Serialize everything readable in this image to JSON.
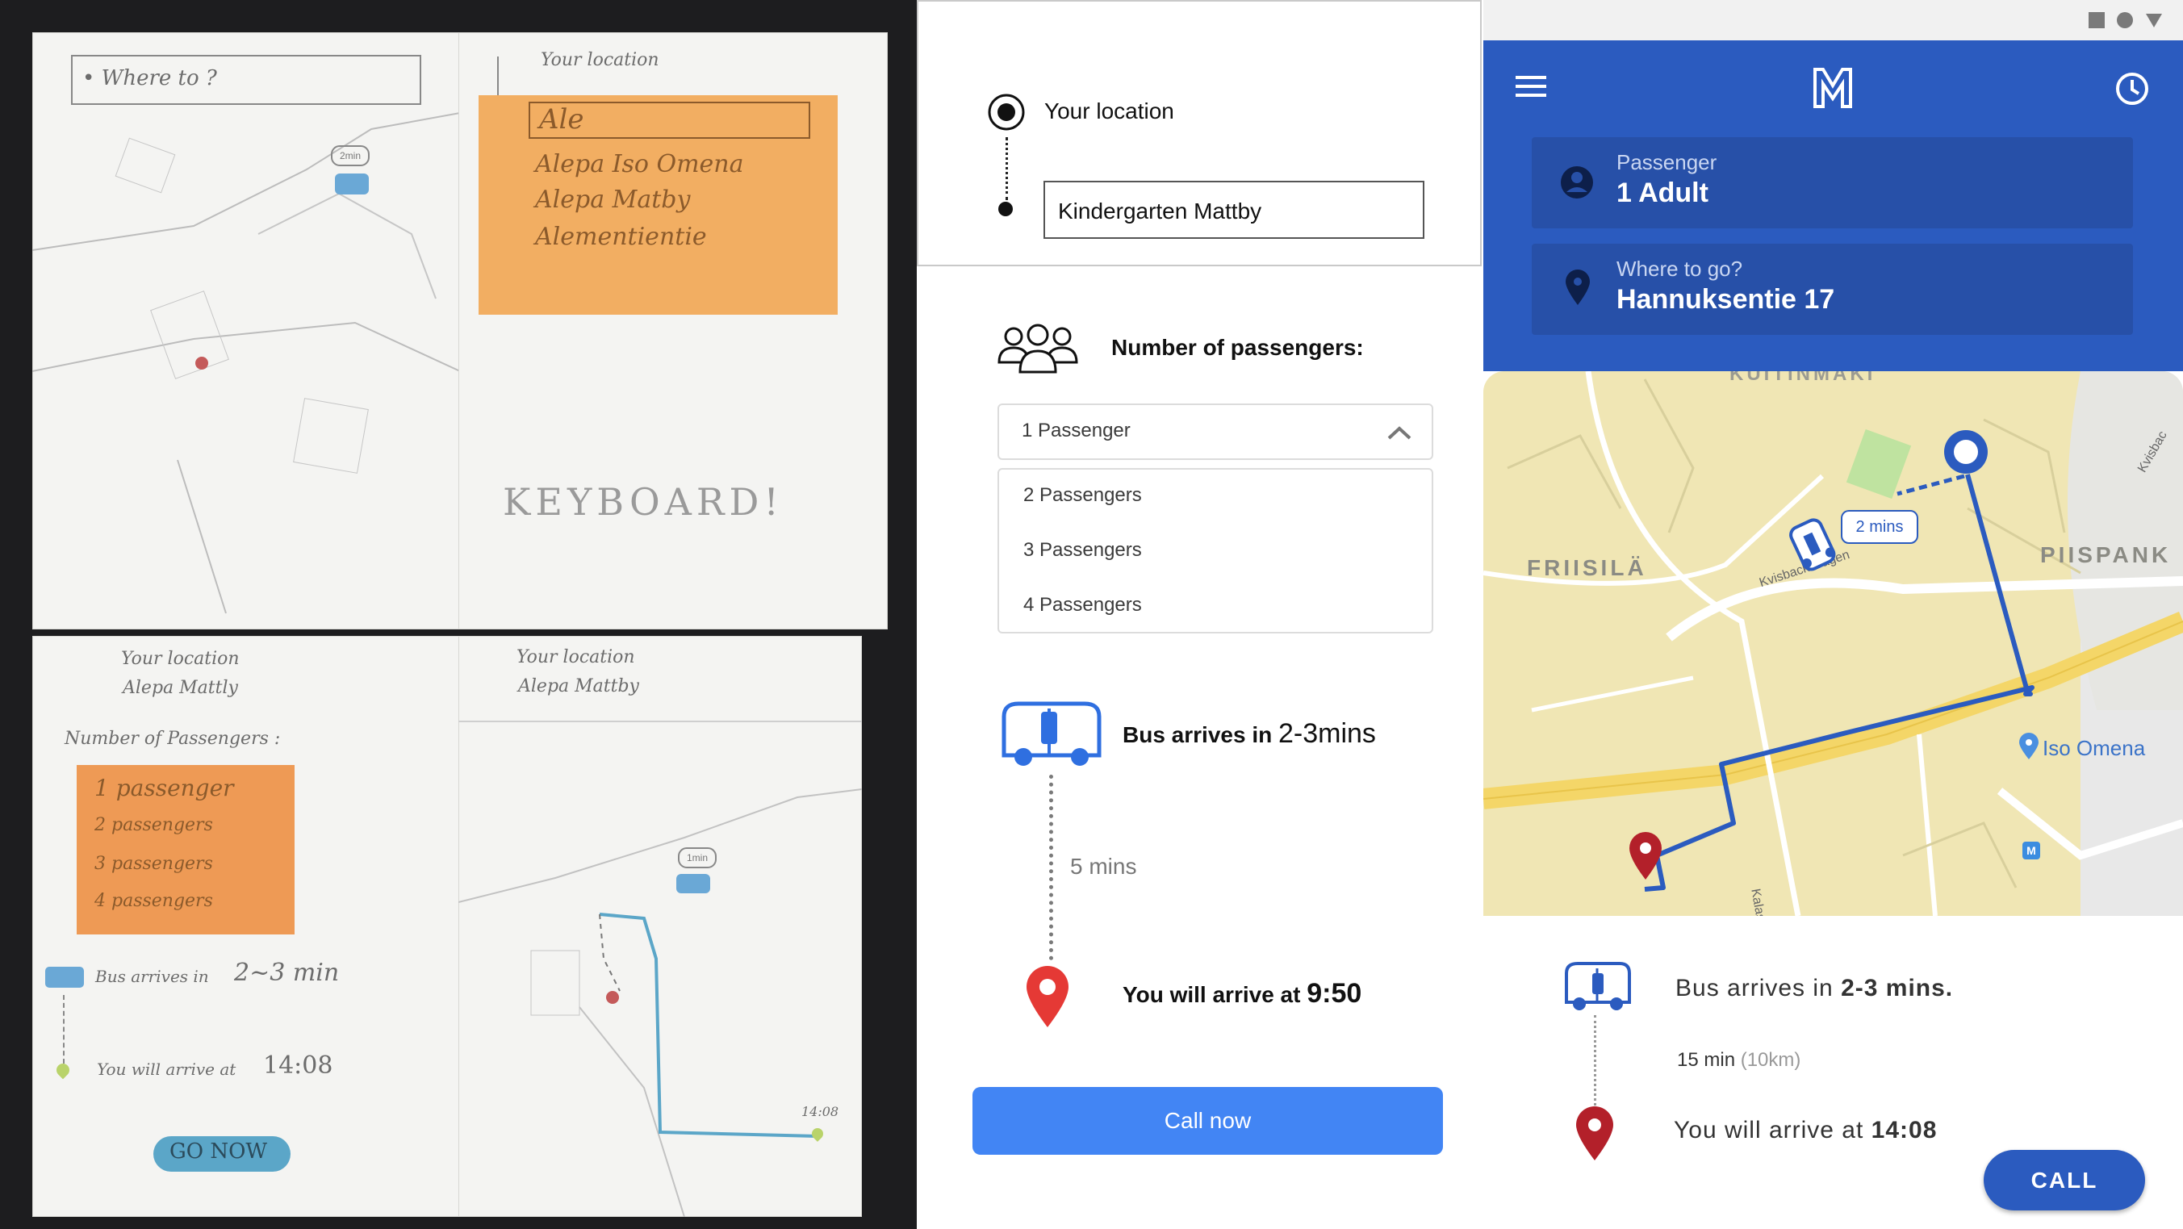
{
  "sketch": {
    "where_to": "• Where to ?",
    "your_location": "Your location",
    "typed": "Ale",
    "suggestions": [
      "Alepa Iso Omena",
      "Alepa Matby",
      "Alementientie"
    ],
    "keyboard": "KEYBOARD!",
    "origin": "Alepa Mattly",
    "origin_2": "Alepa Mattby",
    "passengers_heading": "Number of Passengers :",
    "passenger_options": [
      "1 passenger",
      "2 passengers",
      "3 passengers",
      "4 passengers"
    ],
    "bus_arrives": "Bus arrives in",
    "bus_time": "2~3 min",
    "you_will_arrive": "You will arrive at",
    "arrive_time": "14:08",
    "go_now": "GO NOW",
    "bubble_1": "2min",
    "bubble_2": "1min",
    "map_time": "14:08"
  },
  "mid": {
    "your_location": "Your location",
    "destination_value": "Kindergarten Mattby",
    "passengers_label": "Number of passengers:",
    "selected": "1 Passenger",
    "options": [
      "2 Passengers",
      "3 Passengers",
      "4 Passengers"
    ],
    "bus_prefix": "Bus arrives in ",
    "bus_time": "2-3mins",
    "duration": "5 mins",
    "arrive_prefix": "You will arrive at ",
    "arrive_time": "9:50",
    "call_now": "Call now"
  },
  "app": {
    "passenger_label": "Passenger",
    "passenger_value": "1 Adult",
    "where_label": "Where to go?",
    "where_value": "Hannuksentie 17",
    "map_labels": {
      "friisila": "FRIISILÄ",
      "piispank": "PIISPANK",
      "kvisback": "Kvisbackavägen",
      "iso_omena": "Iso Omena",
      "kalastajan": "Kalastajan",
      "kvisba": "Kvisbac",
      "top_road": "KUITINMÄKI"
    },
    "bus_bubble": "2 mins",
    "bus_prefix": "Bus arrives in ",
    "bus_time": "2-3 mins.",
    "duration": "15 min",
    "distance": "(10km)",
    "arrive_prefix": "You will arrive at ",
    "arrive_time": "14:08",
    "call": "CALL"
  },
  "colors": {
    "app_blue": "#2b5bbf",
    "call_now_blue": "#4285f4",
    "pin_red": "#b3202a",
    "mid_pin_red": "#e53935",
    "sticky_orange": "#f2ae62"
  }
}
